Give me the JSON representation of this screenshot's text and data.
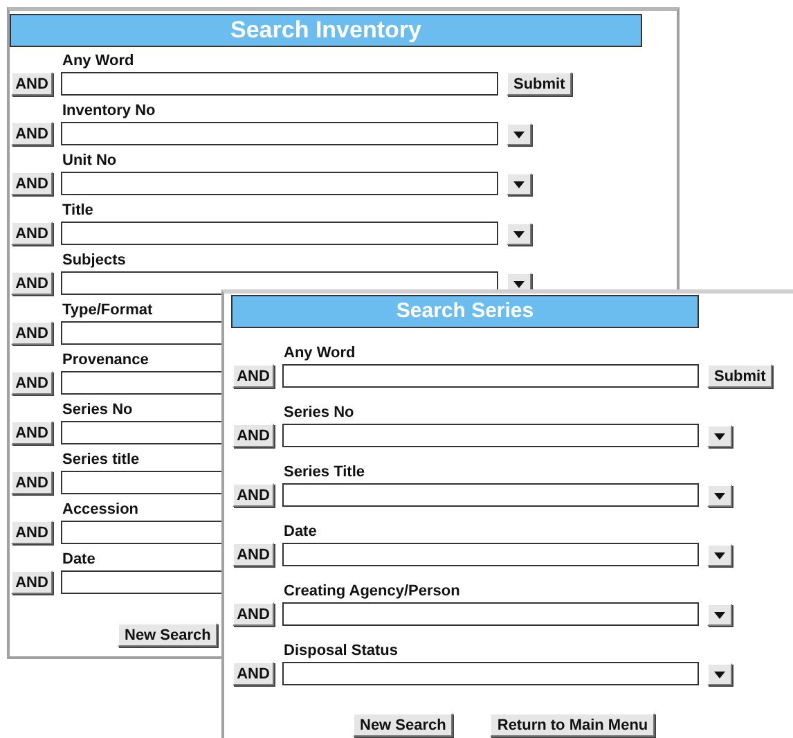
{
  "windows": [
    {
      "title": "Search Inventory",
      "fields": [
        {
          "label": "Any Word",
          "operator": "AND",
          "kind": "submit",
          "action": "Submit"
        },
        {
          "label": "Inventory No",
          "operator": "AND",
          "kind": "select"
        },
        {
          "label": "Unit No",
          "operator": "AND",
          "kind": "select"
        },
        {
          "label": "Title",
          "operator": "AND",
          "kind": "select"
        },
        {
          "label": "Subjects",
          "operator": "AND",
          "kind": "select"
        },
        {
          "label": "Type/Format",
          "operator": "AND",
          "kind": "text"
        },
        {
          "label": "Provenance",
          "operator": "AND",
          "kind": "text"
        },
        {
          "label": "Series No",
          "operator": "AND",
          "kind": "text"
        },
        {
          "label": "Series title",
          "operator": "AND",
          "kind": "text"
        },
        {
          "label": "Accession",
          "operator": "AND",
          "kind": "text"
        },
        {
          "label": "Date",
          "operator": "AND",
          "kind": "text"
        }
      ],
      "buttons": [
        "New Search"
      ]
    },
    {
      "title": "Search Series",
      "fields": [
        {
          "label": "Any Word",
          "operator": "AND",
          "kind": "submit",
          "action": "Submit"
        },
        {
          "label": "Series No",
          "operator": "AND",
          "kind": "select"
        },
        {
          "label": "Series Title",
          "operator": "AND",
          "kind": "select"
        },
        {
          "label": "Date",
          "operator": "AND",
          "kind": "select"
        },
        {
          "label": "Creating Agency/Person",
          "operator": "AND",
          "kind": "select"
        },
        {
          "label": "Disposal Status",
          "operator": "AND",
          "kind": "select"
        }
      ],
      "buttons": [
        "New Search",
        "Return to Main Menu"
      ]
    }
  ]
}
